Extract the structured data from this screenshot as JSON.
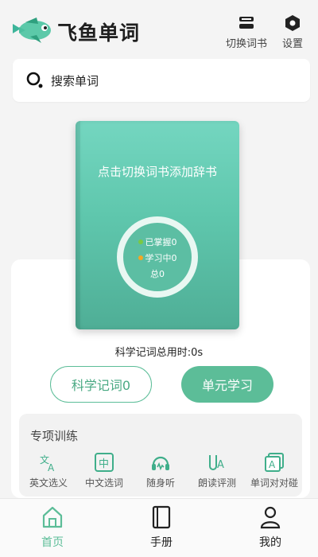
{
  "app": {
    "title": "飞鱼单词",
    "logo_icon": "flying-fish-logo"
  },
  "header": {
    "switch_book_label": "切换词书",
    "switch_book_icon": "book-stack-icon",
    "settings_label": "设置",
    "settings_icon": "hexagon-gear-icon"
  },
  "search": {
    "placeholder": "搜索单词",
    "icon": "search-icon"
  },
  "book": {
    "cover_text": "点击切换词书添加辞书",
    "mastered_label": "已掌握0",
    "learning_label": "学习中0",
    "total_label": "总0",
    "mastered_color": "#7ac943",
    "learning_color": "#f5a623"
  },
  "stats": {
    "memory_time": "科学记词总用时:0s"
  },
  "actions": {
    "scientific_memory_label": "科学记词0",
    "unit_study_label": "单元学习",
    "accent_color": "#5cbd98"
  },
  "training": {
    "title": "专项训练",
    "items": [
      {
        "label": "英文选义",
        "icon": "translate-icon"
      },
      {
        "label": "中文选词",
        "icon": "chinese-char-icon"
      },
      {
        "label": "随身听",
        "icon": "headphones-icon"
      },
      {
        "label": "朗读评测",
        "icon": "pronunciation-icon"
      },
      {
        "label": "单词对对碰",
        "icon": "word-match-icon"
      }
    ]
  },
  "tabbar": {
    "items": [
      {
        "label": "首页",
        "icon": "home-icon",
        "active": true
      },
      {
        "label": "手册",
        "icon": "handbook-icon",
        "active": false
      },
      {
        "label": "我的",
        "icon": "user-icon",
        "active": false
      }
    ],
    "active_color": "#5cbd98"
  }
}
